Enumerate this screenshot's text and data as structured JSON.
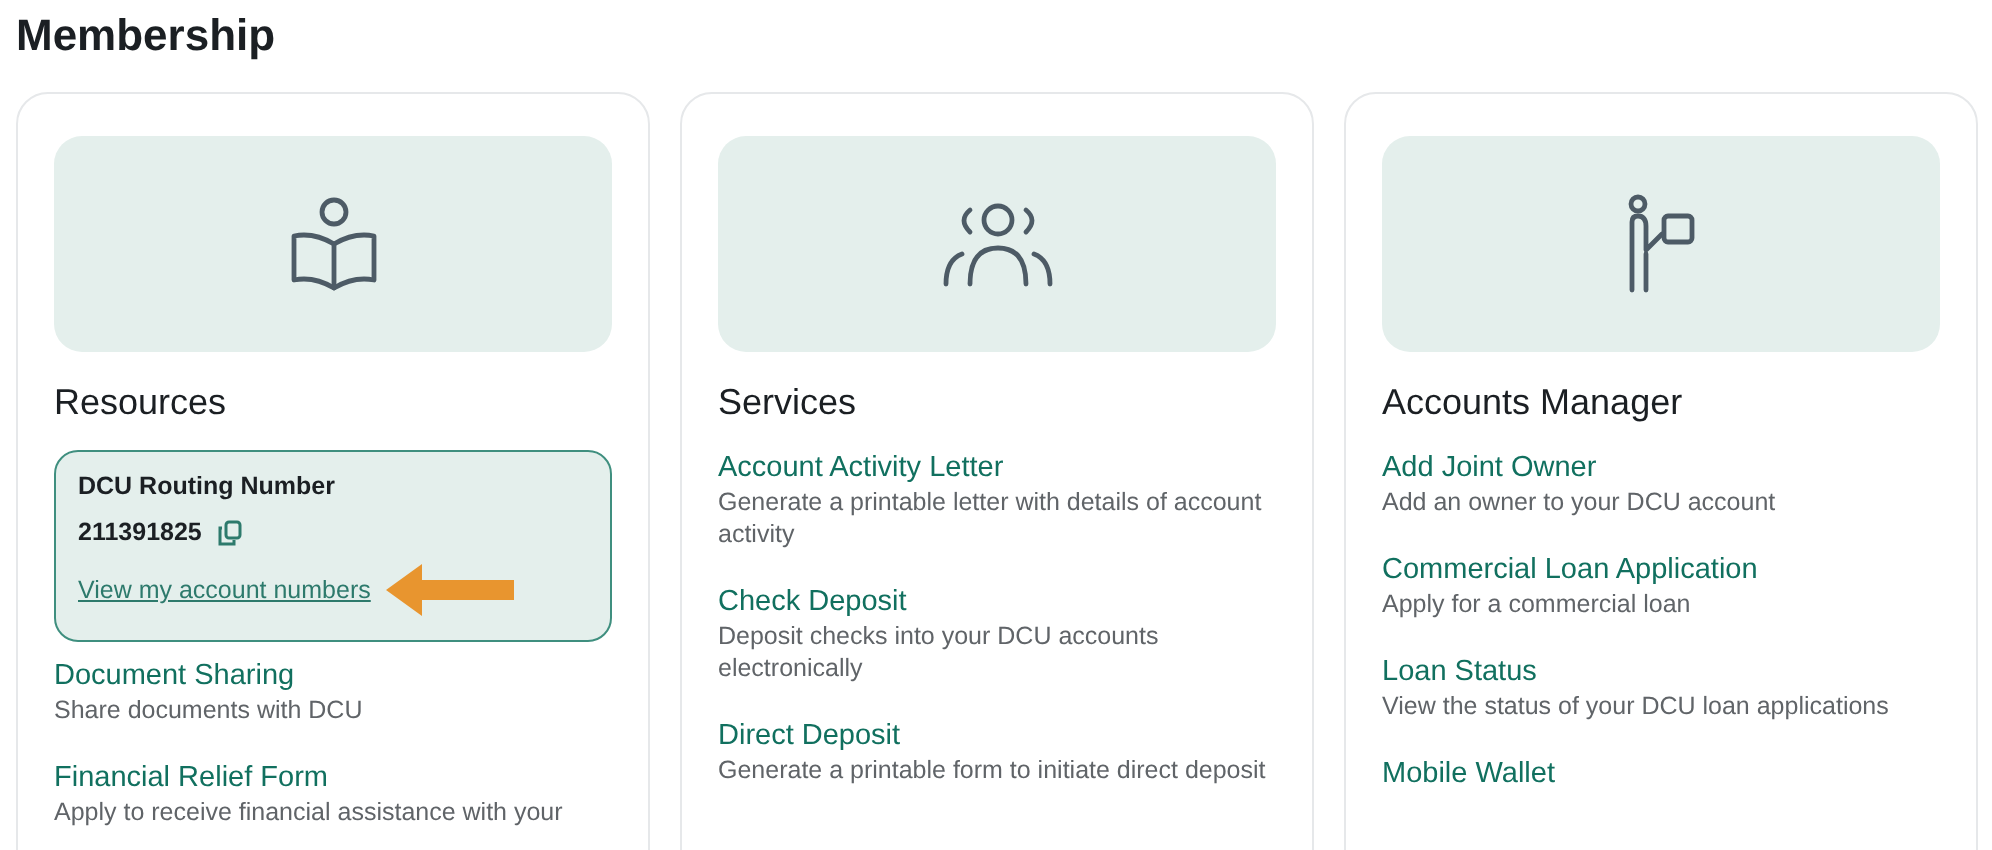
{
  "title": "Membership",
  "cards": [
    {
      "heading": "Resources",
      "routing": {
        "label": "DCU Routing Number",
        "number": "211391825",
        "link": "View my account numbers"
      },
      "links": [
        {
          "title": "Document Sharing",
          "description": "Share documents with DCU"
        },
        {
          "title": "Financial Relief Form",
          "description": "Apply to receive financial assistance with your"
        }
      ]
    },
    {
      "heading": "Services",
      "links": [
        {
          "title": "Account Activity Letter",
          "description": "Generate a printable letter with details of account activity"
        },
        {
          "title": "Check Deposit",
          "description": "Deposit checks into your DCU accounts electronically"
        },
        {
          "title": "Direct Deposit",
          "description": "Generate a printable form to initiate direct deposit"
        }
      ]
    },
    {
      "heading": "Accounts Manager",
      "links": [
        {
          "title": "Add Joint Owner",
          "description": "Add an owner to your DCU account"
        },
        {
          "title": "Commercial Loan Application",
          "description": "Apply for a commercial loan"
        },
        {
          "title": "Loan Status",
          "description": "View the status of your DCU loan applications"
        },
        {
          "title": "Mobile Wallet"
        }
      ]
    }
  ]
}
